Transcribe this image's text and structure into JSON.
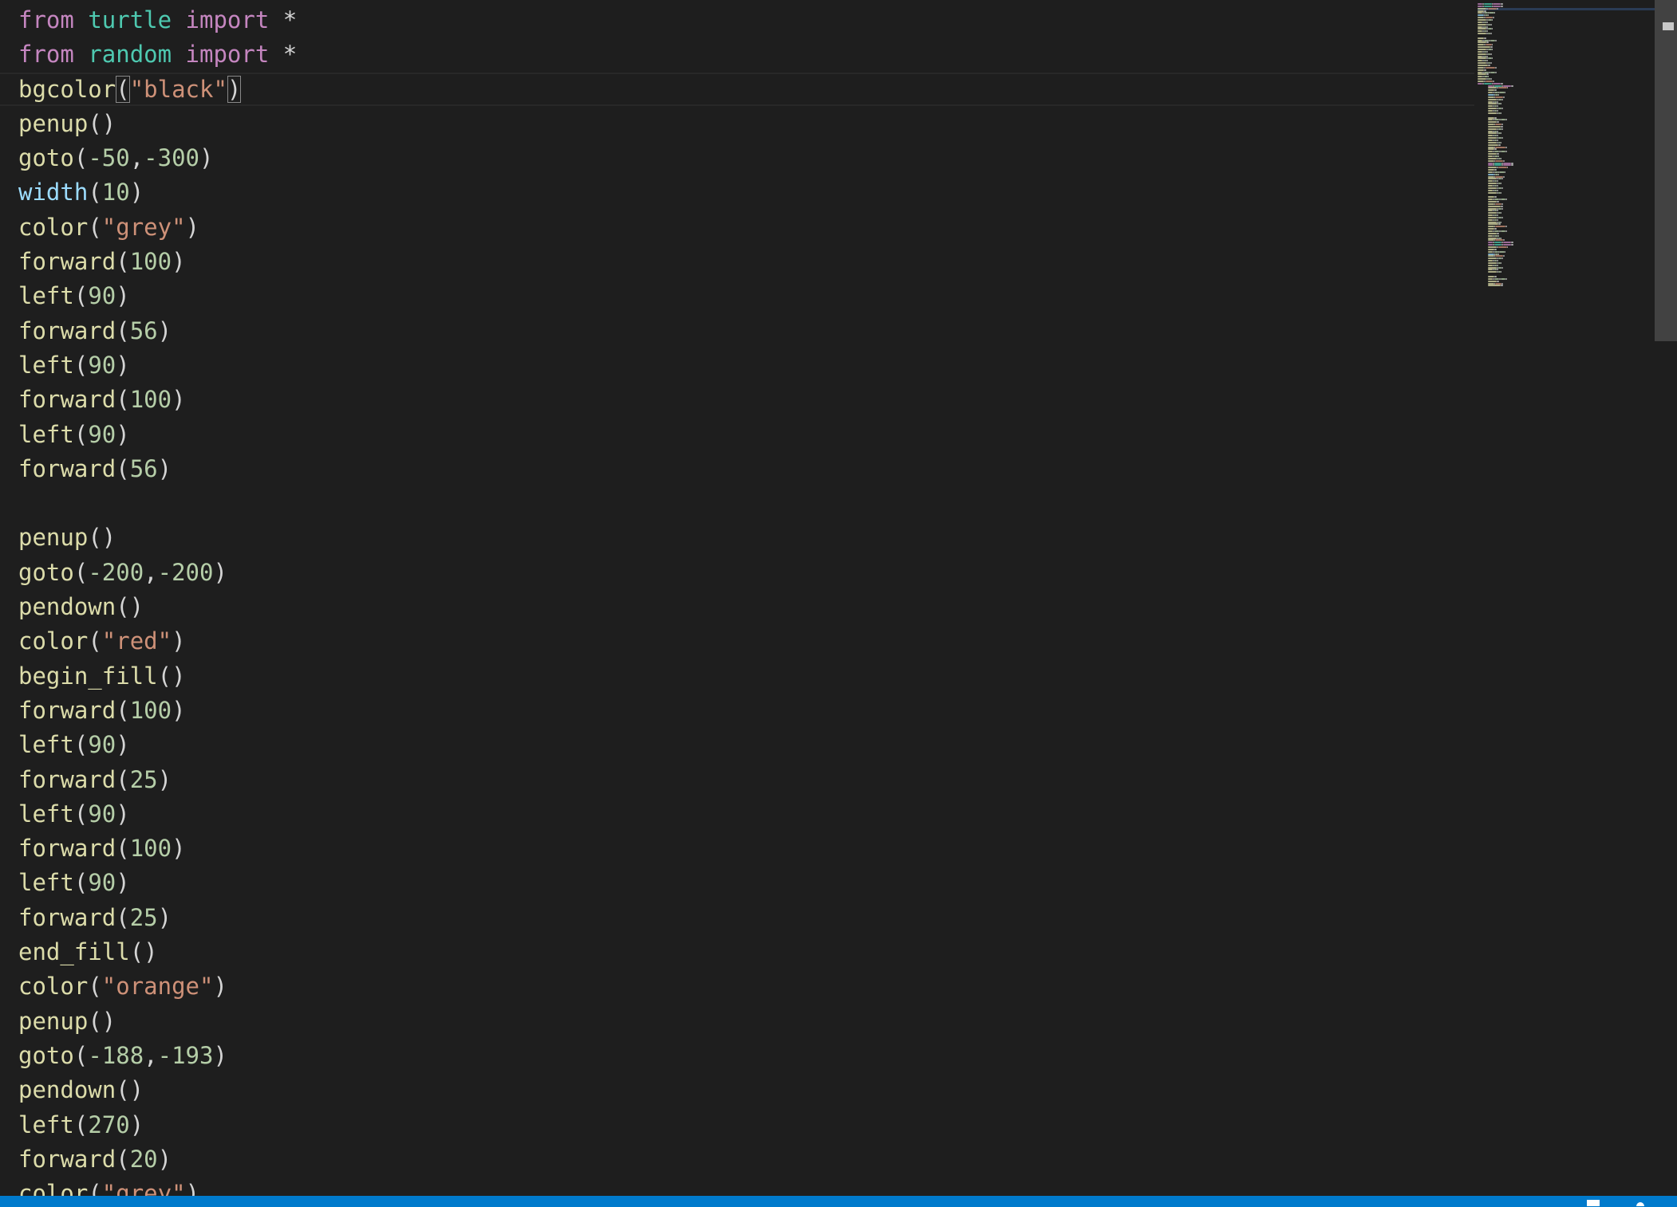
{
  "editor": {
    "lines": [
      [
        {
          "t": "from",
          "c": "kw"
        },
        {
          "t": " "
        },
        {
          "t": "turtle",
          "c": "mod"
        },
        {
          "t": " "
        },
        {
          "t": "import",
          "c": "kw"
        },
        {
          "t": " *",
          "c": "op"
        }
      ],
      [
        {
          "t": "from",
          "c": "kw"
        },
        {
          "t": " "
        },
        {
          "t": "random",
          "c": "mod"
        },
        {
          "t": " "
        },
        {
          "t": "import",
          "c": "kw"
        },
        {
          "t": " *",
          "c": "op"
        }
      ],
      [
        {
          "t": "bgcolor",
          "c": "fn"
        },
        {
          "t": "(",
          "c": "bracket-match"
        },
        {
          "t": "\"black\"",
          "c": "str"
        },
        {
          "t": ")",
          "c": "bracket-match"
        }
      ],
      [
        {
          "t": "penup",
          "c": "fn"
        },
        {
          "t": "()",
          "c": "punc"
        }
      ],
      [
        {
          "t": "goto",
          "c": "fn"
        },
        {
          "t": "(",
          "c": "punc"
        },
        {
          "t": "-50",
          "c": "num"
        },
        {
          "t": ",",
          "c": "punc"
        },
        {
          "t": "-300",
          "c": "num"
        },
        {
          "t": ")",
          "c": "punc"
        }
      ],
      [
        {
          "t": "width",
          "c": "builtin"
        },
        {
          "t": "(",
          "c": "punc"
        },
        {
          "t": "10",
          "c": "num"
        },
        {
          "t": ")",
          "c": "punc"
        }
      ],
      [
        {
          "t": "color",
          "c": "fn"
        },
        {
          "t": "(",
          "c": "punc"
        },
        {
          "t": "\"grey\"",
          "c": "str"
        },
        {
          "t": ")",
          "c": "punc"
        }
      ],
      [
        {
          "t": "forward",
          "c": "fn"
        },
        {
          "t": "(",
          "c": "punc"
        },
        {
          "t": "100",
          "c": "num"
        },
        {
          "t": ")",
          "c": "punc"
        }
      ],
      [
        {
          "t": "left",
          "c": "fn"
        },
        {
          "t": "(",
          "c": "punc"
        },
        {
          "t": "90",
          "c": "num"
        },
        {
          "t": ")",
          "c": "punc"
        }
      ],
      [
        {
          "t": "forward",
          "c": "fn"
        },
        {
          "t": "(",
          "c": "punc"
        },
        {
          "t": "56",
          "c": "num"
        },
        {
          "t": ")",
          "c": "punc"
        }
      ],
      [
        {
          "t": "left",
          "c": "fn"
        },
        {
          "t": "(",
          "c": "punc"
        },
        {
          "t": "90",
          "c": "num"
        },
        {
          "t": ")",
          "c": "punc"
        }
      ],
      [
        {
          "t": "forward",
          "c": "fn"
        },
        {
          "t": "(",
          "c": "punc"
        },
        {
          "t": "100",
          "c": "num"
        },
        {
          "t": ")",
          "c": "punc"
        }
      ],
      [
        {
          "t": "left",
          "c": "fn"
        },
        {
          "t": "(",
          "c": "punc"
        },
        {
          "t": "90",
          "c": "num"
        },
        {
          "t": ")",
          "c": "punc"
        }
      ],
      [
        {
          "t": "forward",
          "c": "fn"
        },
        {
          "t": "(",
          "c": "punc"
        },
        {
          "t": "56",
          "c": "num"
        },
        {
          "t": ")",
          "c": "punc"
        }
      ],
      [],
      [
        {
          "t": "penup",
          "c": "fn"
        },
        {
          "t": "()",
          "c": "punc"
        }
      ],
      [
        {
          "t": "goto",
          "c": "fn"
        },
        {
          "t": "(",
          "c": "punc"
        },
        {
          "t": "-200",
          "c": "num"
        },
        {
          "t": ",",
          "c": "punc"
        },
        {
          "t": "-200",
          "c": "num"
        },
        {
          "t": ")",
          "c": "punc"
        }
      ],
      [
        {
          "t": "pendown",
          "c": "fn"
        },
        {
          "t": "()",
          "c": "punc"
        }
      ],
      [
        {
          "t": "color",
          "c": "fn"
        },
        {
          "t": "(",
          "c": "punc"
        },
        {
          "t": "\"red\"",
          "c": "str"
        },
        {
          "t": ")",
          "c": "punc"
        }
      ],
      [
        {
          "t": "begin_fill",
          "c": "fn"
        },
        {
          "t": "()",
          "c": "punc"
        }
      ],
      [
        {
          "t": "forward",
          "c": "fn"
        },
        {
          "t": "(",
          "c": "punc"
        },
        {
          "t": "100",
          "c": "num"
        },
        {
          "t": ")",
          "c": "punc"
        }
      ],
      [
        {
          "t": "left",
          "c": "fn"
        },
        {
          "t": "(",
          "c": "punc"
        },
        {
          "t": "90",
          "c": "num"
        },
        {
          "t": ")",
          "c": "punc"
        }
      ],
      [
        {
          "t": "forward",
          "c": "fn"
        },
        {
          "t": "(",
          "c": "punc"
        },
        {
          "t": "25",
          "c": "num"
        },
        {
          "t": ")",
          "c": "punc"
        }
      ],
      [
        {
          "t": "left",
          "c": "fn"
        },
        {
          "t": "(",
          "c": "punc"
        },
        {
          "t": "90",
          "c": "num"
        },
        {
          "t": ")",
          "c": "punc"
        }
      ],
      [
        {
          "t": "forward",
          "c": "fn"
        },
        {
          "t": "(",
          "c": "punc"
        },
        {
          "t": "100",
          "c": "num"
        },
        {
          "t": ")",
          "c": "punc"
        }
      ],
      [
        {
          "t": "left",
          "c": "fn"
        },
        {
          "t": "(",
          "c": "punc"
        },
        {
          "t": "90",
          "c": "num"
        },
        {
          "t": ")",
          "c": "punc"
        }
      ],
      [
        {
          "t": "forward",
          "c": "fn"
        },
        {
          "t": "(",
          "c": "punc"
        },
        {
          "t": "25",
          "c": "num"
        },
        {
          "t": ")",
          "c": "punc"
        }
      ],
      [
        {
          "t": "end_fill",
          "c": "fn"
        },
        {
          "t": "()",
          "c": "punc"
        }
      ],
      [
        {
          "t": "color",
          "c": "fn"
        },
        {
          "t": "(",
          "c": "punc"
        },
        {
          "t": "\"orange\"",
          "c": "str"
        },
        {
          "t": ")",
          "c": "punc"
        }
      ],
      [
        {
          "t": "penup",
          "c": "fn"
        },
        {
          "t": "()",
          "c": "punc"
        }
      ],
      [
        {
          "t": "goto",
          "c": "fn"
        },
        {
          "t": "(",
          "c": "punc"
        },
        {
          "t": "-188",
          "c": "num"
        },
        {
          "t": ",",
          "c": "punc"
        },
        {
          "t": "-193",
          "c": "num"
        },
        {
          "t": ")",
          "c": "punc"
        }
      ],
      [
        {
          "t": "pendown",
          "c": "fn"
        },
        {
          "t": "()",
          "c": "punc"
        }
      ],
      [
        {
          "t": "left",
          "c": "fn"
        },
        {
          "t": "(",
          "c": "punc"
        },
        {
          "t": "270",
          "c": "num"
        },
        {
          "t": ")",
          "c": "punc"
        }
      ],
      [
        {
          "t": "forward",
          "c": "fn"
        },
        {
          "t": "(",
          "c": "punc"
        },
        {
          "t": "20",
          "c": "num"
        },
        {
          "t": ")",
          "c": "punc"
        }
      ],
      [
        {
          "t": "color",
          "c": "fn"
        },
        {
          "t": "(",
          "c": "punc"
        },
        {
          "t": "\"grey\"",
          "c": "str"
        },
        {
          "t": ")",
          "c": "punc"
        }
      ]
    ]
  },
  "theme": {
    "background": "#1e1e1e",
    "keyword": "#c586c0",
    "module": "#4ec9b0",
    "string": "#ce9178",
    "number": "#b5cea8",
    "function": "#dcdcaa",
    "builtin": "#9cdcfe",
    "text": "#d4d4d4",
    "statusbar": "#007acc"
  },
  "statusbar": {
    "icons": [
      "feedback-icon",
      "bell-icon"
    ]
  }
}
